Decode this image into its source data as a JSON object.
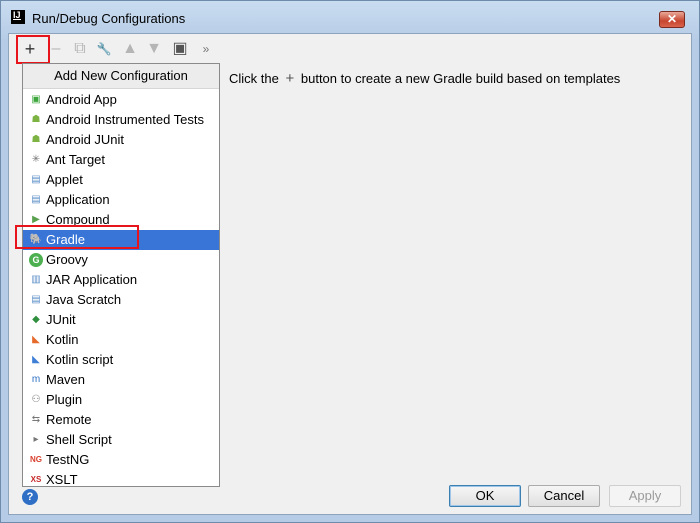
{
  "window": {
    "title": "Run/Debug Configurations",
    "close_label": "✕",
    "app_icon": "IJ"
  },
  "toolbar": {
    "icons": [
      "plus-icon",
      "minus-icon",
      "copy-icon",
      "wrench-icon",
      "arrow-up-icon",
      "arrow-down-icon",
      "new-folder-icon",
      "more-icon"
    ],
    "glyphs": [
      "+",
      "–",
      "⧉",
      "🔧",
      "▲",
      "▼",
      "▣",
      "»"
    ]
  },
  "popup": {
    "header": "Add New Configuration",
    "items": [
      {
        "label": "Android App",
        "icon": "android-app-icon",
        "glyph": "▣",
        "color": "#3da73d"
      },
      {
        "label": "Android Instrumented Tests",
        "icon": "android-icon",
        "glyph": "☗",
        "color": "#7cb342"
      },
      {
        "label": "Android JUnit",
        "icon": "android-icon",
        "glyph": "☗",
        "color": "#7cb342"
      },
      {
        "label": "Ant Target",
        "icon": "ant-icon",
        "glyph": "✳",
        "color": "#777777"
      },
      {
        "label": "Applet",
        "icon": "applet-icon",
        "glyph": "▤",
        "color": "#5b8ec7"
      },
      {
        "label": "Application",
        "icon": "application-icon",
        "glyph": "▤",
        "color": "#5b8ec7"
      },
      {
        "label": "Compound",
        "icon": "compound-icon",
        "glyph": "▶",
        "color": "#5aa14f"
      },
      {
        "label": "Gradle",
        "icon": "gradle-icon",
        "glyph": "🐘",
        "color": "#3d6fa8"
      },
      {
        "label": "Groovy",
        "icon": "groovy-icon",
        "glyph": "G",
        "color": "#4caf50"
      },
      {
        "label": "JAR Application",
        "icon": "jar-icon",
        "glyph": "▥",
        "color": "#5b8ec7"
      },
      {
        "label": "Java Scratch",
        "icon": "java-scratch-icon",
        "glyph": "▤",
        "color": "#5b8ec7"
      },
      {
        "label": "JUnit",
        "icon": "junit-icon",
        "glyph": "◆",
        "color": "#2f8f3f"
      },
      {
        "label": "Kotlin",
        "icon": "kotlin-icon",
        "glyph": "◣",
        "color": "#e66a2c"
      },
      {
        "label": "Kotlin script",
        "icon": "kotlin-script-icon",
        "glyph": "◣",
        "color": "#3f7fd6"
      },
      {
        "label": "Maven",
        "icon": "maven-icon",
        "glyph": "m",
        "color": "#2c6fc1"
      },
      {
        "label": "Plugin",
        "icon": "plugin-icon",
        "glyph": "⚇",
        "color": "#777777"
      },
      {
        "label": "Remote",
        "icon": "remote-icon",
        "glyph": "⇆",
        "color": "#777777"
      },
      {
        "label": "Shell Script",
        "icon": "shell-script-icon",
        "glyph": "▸",
        "color": "#777777"
      },
      {
        "label": "TestNG",
        "icon": "testng-icon",
        "glyph": "NG",
        "color": "#d9412f"
      },
      {
        "label": "XSLT",
        "icon": "xslt-icon",
        "glyph": "XS",
        "color": "#c62828"
      }
    ],
    "selected": "Gradle"
  },
  "hint": {
    "before": "Click the",
    "after": "button to create a new Gradle build based on templates"
  },
  "buttons": {
    "ok": "OK",
    "cancel": "Cancel",
    "apply": "Apply",
    "help": "?"
  }
}
